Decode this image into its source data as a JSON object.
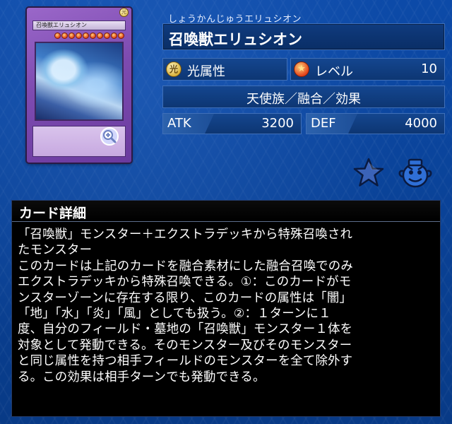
{
  "card": {
    "reading": "しょうかんじゅうエリュシオン",
    "name": "召喚獣エリュシオン",
    "art_name": "召喚獣エリュシオン",
    "art_attribute_glyph": "光",
    "art_level": 10,
    "attribute_label": "光属性",
    "attribute_glyph": "光",
    "level_label": "レベル",
    "level_value": "10",
    "type_line": "天使族／融合／効果",
    "atk_label": "ATK",
    "atk_value": "3200",
    "def_label": "DEF",
    "def_value": "4000"
  },
  "icons": {
    "zoom": "zoom-in-icon",
    "favorite": "star-icon",
    "deck": "pot-icon"
  },
  "details": {
    "title": "カード詳細",
    "text_lines": [
      "「召喚獣」モンスター＋エクストラデッキから特殊召喚され",
      "たモンスター",
      "このカードは上記のカードを融合素材にした融合召喚でのみ",
      "エクストラデッキから特殊召喚できる。①：このカードがモ",
      "ンスターゾーンに存在する限り、このカードの属性は「闇」",
      "「地」「水」「炎」「風」としても扱う。②：１ターンに１",
      "度、自分のフィールド・墓地の「召喚獣」モンスター１体を",
      "対象として発動できる。そのモンスター及びそのモンスター",
      "と同じ属性を持つ相手フィールドのモンスターを全て除外す",
      "る。この効果は相手ターンでも発動できる。"
    ]
  },
  "colors": {
    "background": "#0b3f93",
    "panel": "#000000",
    "box_border": "#3f6fb8",
    "card_frame": "#7d4bb0"
  }
}
